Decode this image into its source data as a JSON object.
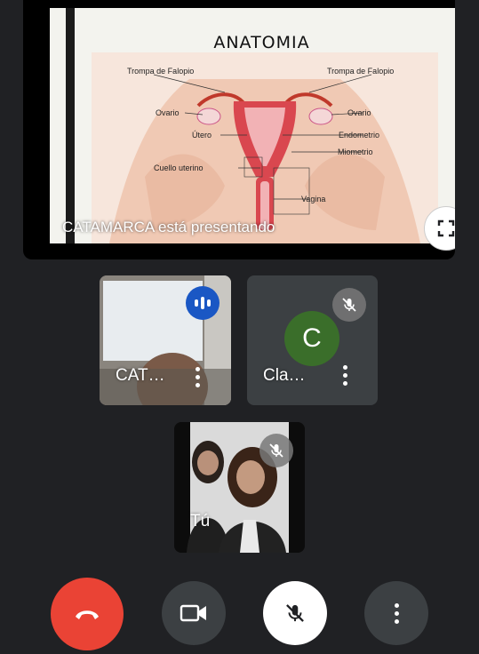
{
  "presentation": {
    "slide_title": "ANATOMIA",
    "labels": {
      "trompa_left": "Trompa de Falopio",
      "trompa_right": "Trompa de Falopio",
      "ovario_left": "Ovario",
      "ovario_right": "Ovario",
      "utero": "Útero",
      "endometrio": "Endometrio",
      "miometrio": "Miometrio",
      "cuello": "Cuello uterino",
      "vagina": "Vagina"
    },
    "caption": "CATAMARCA está presentando",
    "fullscreen_icon": "fullscreen-icon"
  },
  "participants": [
    {
      "name": "CAT…",
      "status": "speaking",
      "icon": "audio-wave-icon"
    },
    {
      "name": "Cla…",
      "status": "muted",
      "icon": "mic-off-icon",
      "avatar_letter": "C",
      "avatar_color": "#3a6e2a"
    },
    {
      "name": "Tú",
      "status": "muted",
      "icon": "mic-off-icon"
    }
  ],
  "controls": [
    {
      "name": "end-call",
      "icon": "hang-up-icon",
      "color": "#ea4335"
    },
    {
      "name": "camera",
      "icon": "videocam-icon",
      "color": "#3c4043"
    },
    {
      "name": "microphone",
      "icon": "mic-off-icon",
      "color": "#ffffff"
    },
    {
      "name": "more-options",
      "icon": "more-vert-icon",
      "color": "#3c4043"
    }
  ]
}
